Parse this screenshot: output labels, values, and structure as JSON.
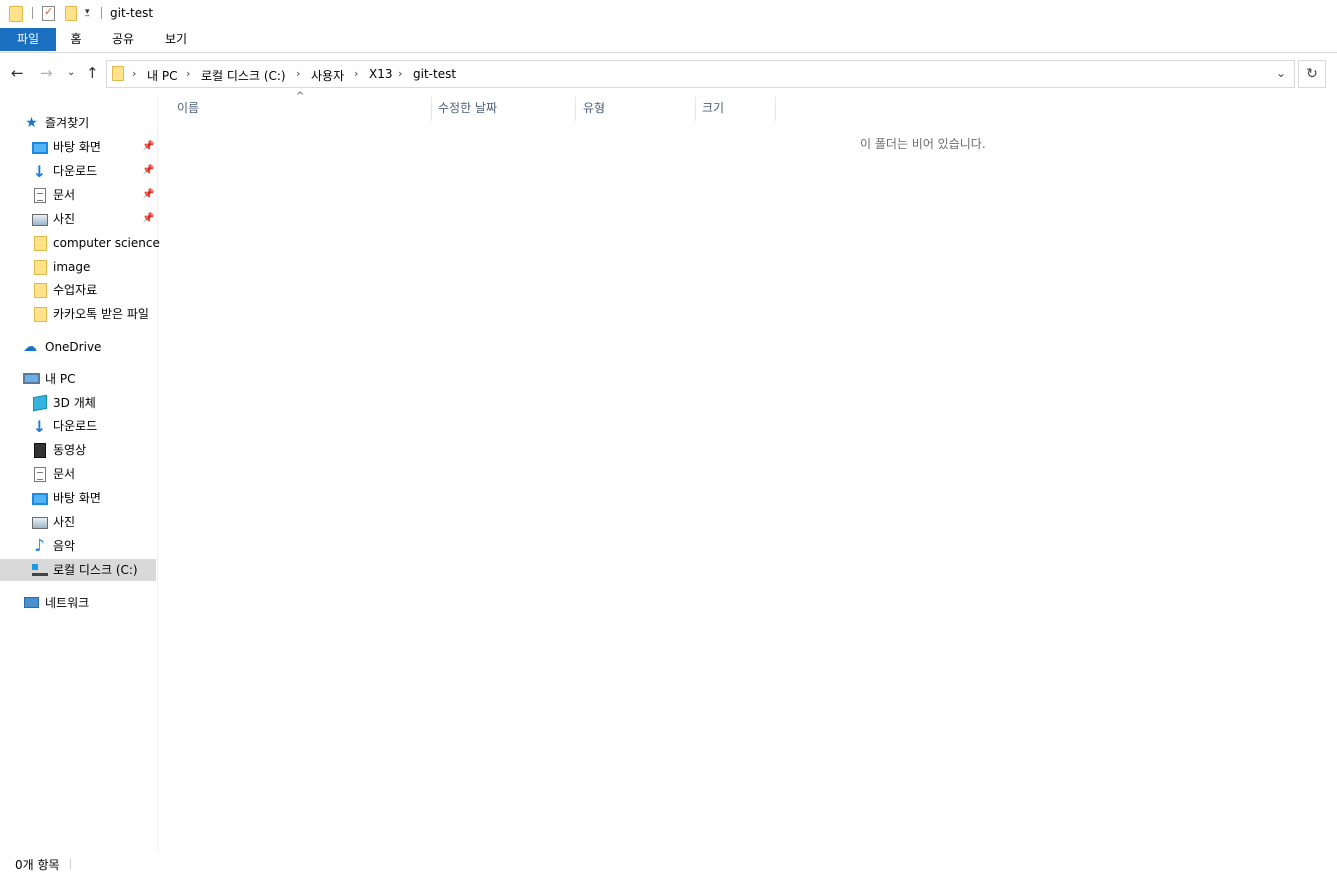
{
  "window": {
    "title": "git-test"
  },
  "ribbon": {
    "tabs": [
      "파일",
      "홈",
      "공유",
      "보기"
    ]
  },
  "address": {
    "crumbs": [
      "내 PC",
      "로컬 디스크 (C:)",
      "사용자",
      "X13",
      "git-test"
    ]
  },
  "sidebar": {
    "quick_access": "즐겨찾기",
    "quick_items": [
      "바탕 화면",
      "다운로드",
      "문서",
      "사진",
      "computer science",
      "image",
      "수업자료",
      "카카오톡 받은 파일"
    ],
    "onedrive": "OneDrive",
    "this_pc": "내 PC",
    "pc_items": [
      "3D 개체",
      "다운로드",
      "동영상",
      "문서",
      "바탕 화면",
      "사진",
      "음악",
      "로컬 디스크 (C:)"
    ],
    "network": "네트워크"
  },
  "columns": [
    "이름",
    "수정한 날짜",
    "유형",
    "크기"
  ],
  "content": {
    "empty_message": "이 폴더는 비어 있습니다."
  },
  "status": {
    "item_count": "0개 항목"
  },
  "colors": {
    "accent": "#1a6fc1",
    "selected": "#d9d9d9"
  }
}
